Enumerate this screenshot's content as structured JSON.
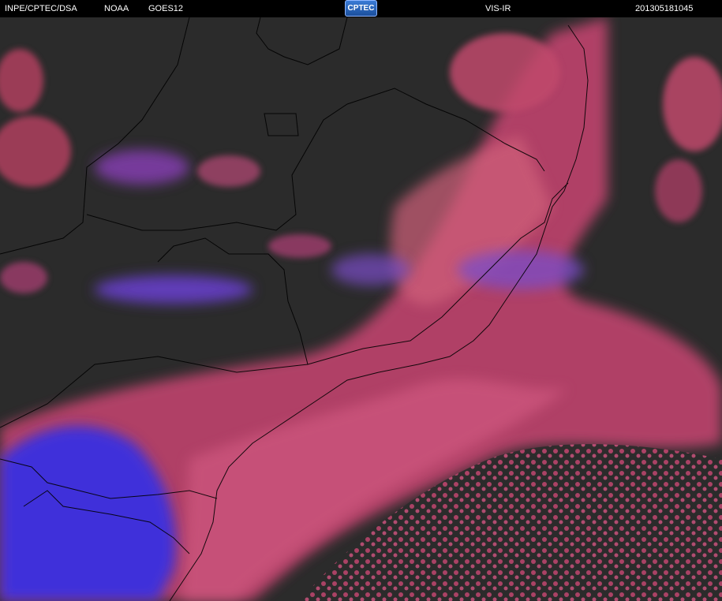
{
  "header": {
    "agency": "INPE/CPTEC/DSA",
    "noaa": "NOAA",
    "satellite": "GOES12",
    "logo_text": "CPTEC",
    "channel": "VIS-IR",
    "timestamp": "201305181045"
  },
  "colors": {
    "background": "#2b2b2b",
    "cloud_warm": "#c8456e",
    "cloud_high": "#6a3fd0",
    "cloud_cold": "#3a2fe0",
    "border_lines": "#000000"
  }
}
